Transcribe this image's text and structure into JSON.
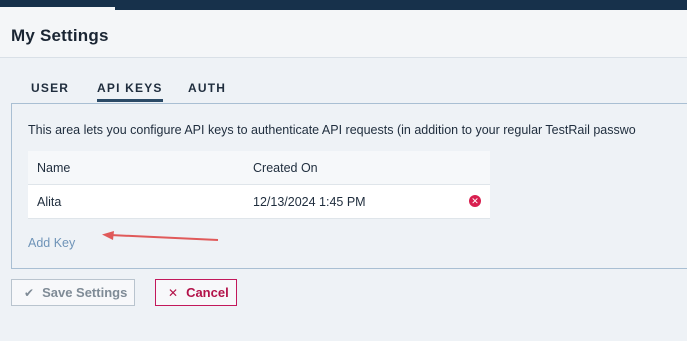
{
  "page": {
    "title": "My Settings"
  },
  "tabs": [
    {
      "label": "USER"
    },
    {
      "label": "API KEYS",
      "active": true
    },
    {
      "label": "AUTH"
    }
  ],
  "api_keys": {
    "intro": "This area lets you configure API keys to authenticate API requests (in addition to your regular TestRail passwo",
    "columns": [
      "Name",
      "Created On"
    ],
    "rows": [
      {
        "name": "Alita",
        "created_on": "12/13/2024 1:45 PM"
      }
    ],
    "add_key_label": "Add Key"
  },
  "actions": {
    "save_label": "Save Settings",
    "cancel_label": "Cancel"
  },
  "colors": {
    "topbar": "#17314b",
    "accent": "#2b4a66",
    "link": "#6f94b8",
    "danger": "#d81f4f",
    "annotation_arrow": "#e05a5a"
  },
  "icons": {
    "delete": "circle-x-icon",
    "save": "check-icon",
    "cancel": "x-icon"
  }
}
